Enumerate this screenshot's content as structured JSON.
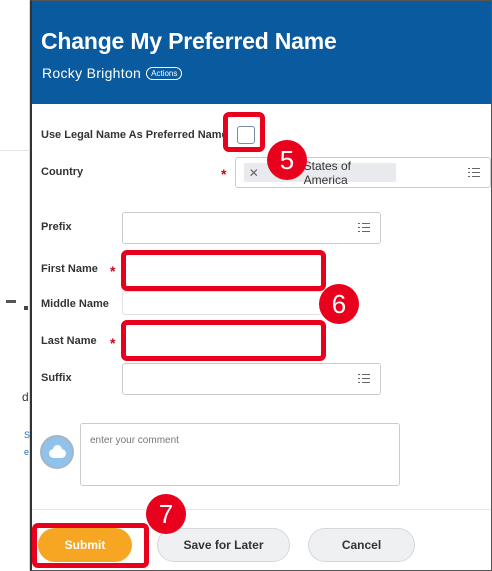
{
  "background": {
    "fragment_d": "d",
    "fragment_s": "S",
    "fragment_e": "e"
  },
  "header": {
    "title": "Change My Preferred Name",
    "worker_name": "Rocky Brighton",
    "actions_label": "Actions"
  },
  "form": {
    "use_legal_name": {
      "label": "Use Legal Name As Preferred Name",
      "checked": false
    },
    "country": {
      "label": "Country",
      "value": "United States of America",
      "visible_value": "States of America",
      "required": true
    },
    "prefix": {
      "label": "Prefix",
      "value": ""
    },
    "first_name": {
      "label": "First Name",
      "value": "",
      "required": true
    },
    "middle_name": {
      "label": "Middle Name",
      "value": ""
    },
    "last_name": {
      "label": "Last Name",
      "value": "",
      "required": true
    },
    "suffix": {
      "label": "Suffix",
      "value": ""
    },
    "required_marker": "*"
  },
  "comment": {
    "placeholder": "enter your comment",
    "avatar_icon": "cloud-icon"
  },
  "buttons": {
    "submit": "Submit",
    "save_for_later": "Save for Later",
    "cancel": "Cancel"
  },
  "annotations": {
    "step_5": "5",
    "step_6": "6",
    "step_7": "7",
    "highlight_color": "#e8001c"
  },
  "colors": {
    "header_bg": "#0a5a9f",
    "submit_bg": "#f6a623",
    "required": "#d0021b"
  }
}
